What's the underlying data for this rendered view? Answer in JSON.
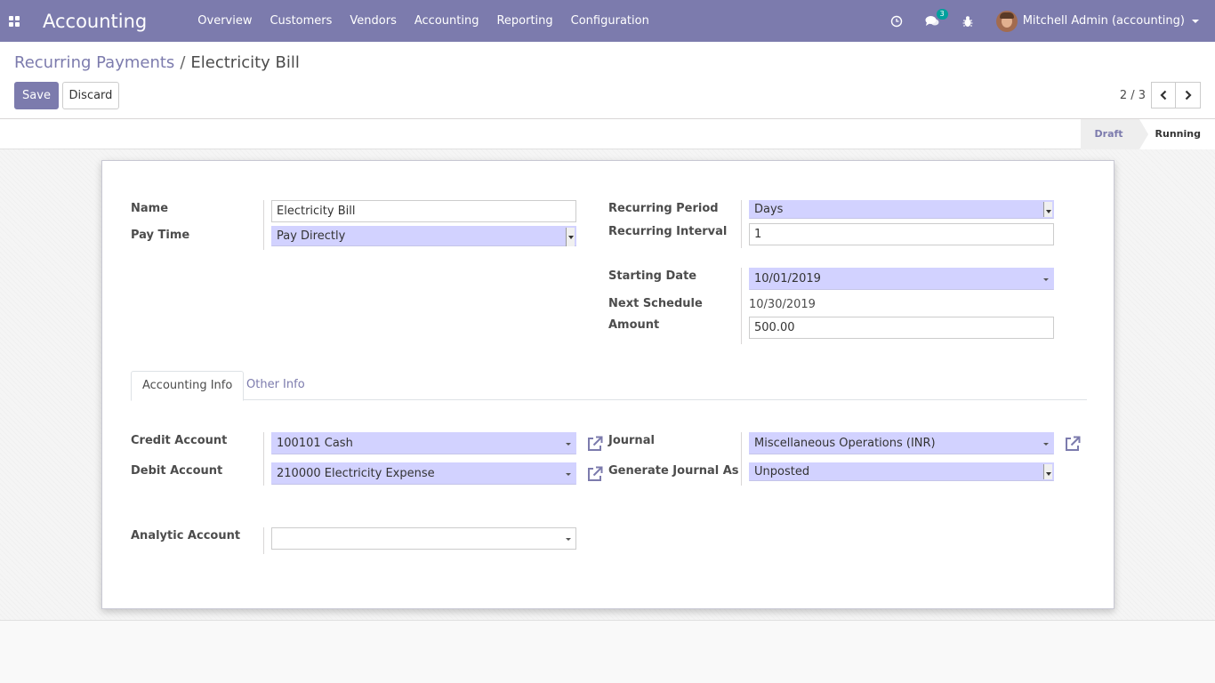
{
  "navbar": {
    "app_title": "Accounting",
    "menu": [
      "Overview",
      "Customers",
      "Vendors",
      "Accounting",
      "Reporting",
      "Configuration"
    ],
    "message_count": "3",
    "user_name": "Mitchell Admin (accounting)",
    "icons": [
      "apps-icon",
      "clock-icon",
      "chat-icon",
      "bug-icon"
    ],
    "color": "#7c7bad"
  },
  "breadcrumb": {
    "parent": "Recurring Payments",
    "current": "Electricity Bill"
  },
  "buttons": {
    "save": "Save",
    "discard": "Discard"
  },
  "pager": {
    "value": "2 / 3"
  },
  "status": {
    "draft": "Draft",
    "running": "Running",
    "current": "Draft"
  },
  "form": {
    "name_label": "Name",
    "name_value": "Electricity Bill",
    "pay_time_label": "Pay Time",
    "pay_time_value": "Pay Directly",
    "recurring_period_label": "Recurring Period",
    "recurring_period_value": "Days",
    "recurring_interval_label": "Recurring Interval",
    "recurring_interval_value": "1",
    "starting_date_label": "Starting Date",
    "starting_date_value": "10/01/2019",
    "next_schedule_label": "Next Schedule",
    "next_schedule_value": "10/30/2019",
    "amount_label": "Amount",
    "amount_value": "500.00"
  },
  "tabs": {
    "accounting_info": "Accounting Info",
    "other_info": "Other Info"
  },
  "accounting": {
    "credit_account_label": "Credit Account",
    "credit_account_value": "100101 Cash",
    "debit_account_label": "Debit Account",
    "debit_account_value": "210000 Electricity Expense",
    "journal_label": "Journal",
    "journal_value": "Miscellaneous Operations (INR)",
    "generate_journal_label": "Generate Journal As",
    "generate_journal_value": "Unposted",
    "analytic_account_label": "Analytic Account",
    "analytic_account_value": ""
  },
  "colors": {
    "primary": "#7c7bad",
    "required_field": "#d2d2ff"
  }
}
